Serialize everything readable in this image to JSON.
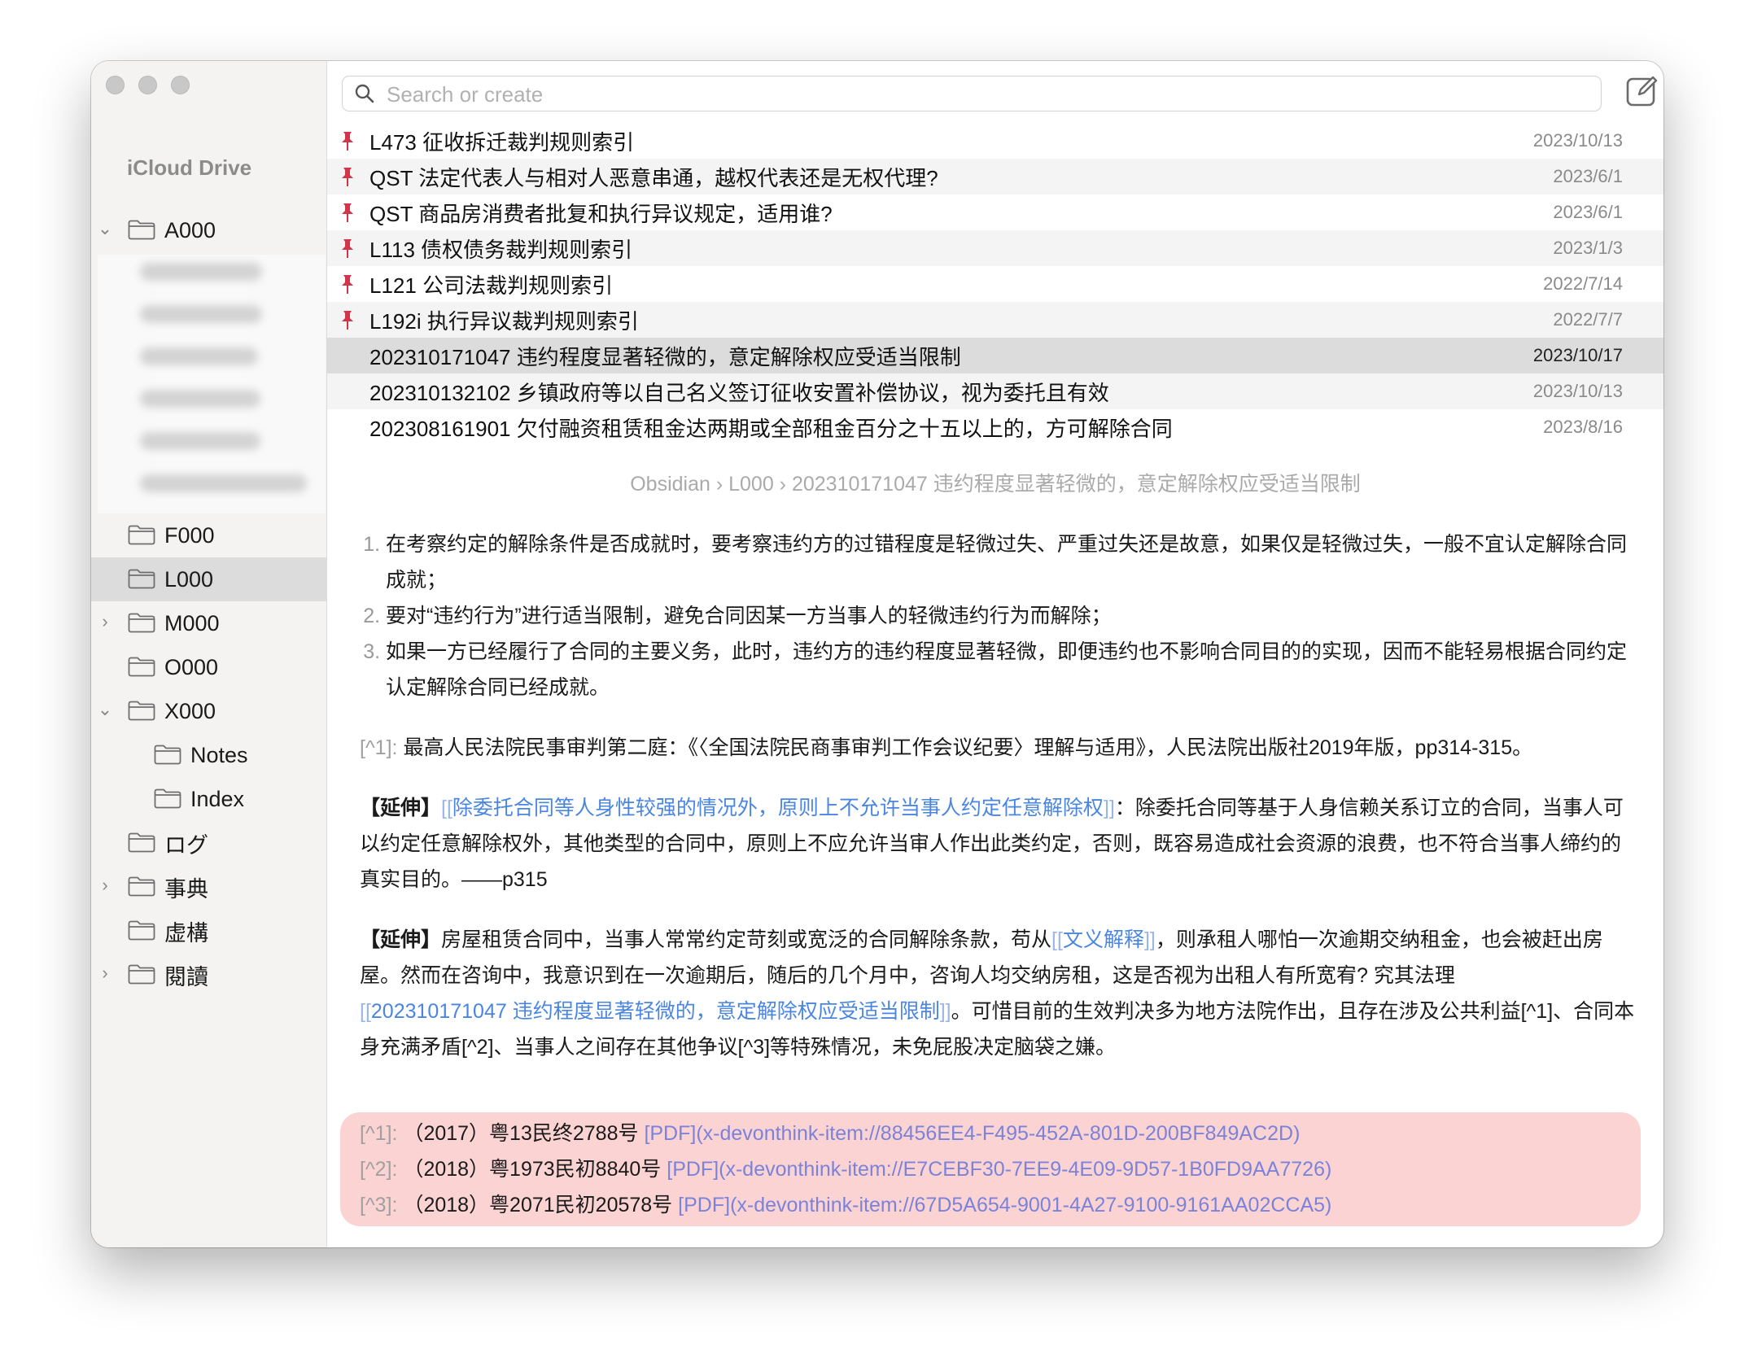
{
  "search": {
    "placeholder": "Search or create"
  },
  "sidebar": {
    "header": "iCloud Drive",
    "folders": [
      {
        "label": "A000",
        "expander": "⌄"
      },
      {
        "label": "F000",
        "expander": ""
      },
      {
        "label": "L000",
        "expander": ""
      },
      {
        "label": "M000",
        "expander": "›"
      },
      {
        "label": "O000",
        "expander": ""
      },
      {
        "label": "X000",
        "expander": "⌄"
      },
      {
        "label": "Notes",
        "expander": ""
      },
      {
        "label": "Index",
        "expander": ""
      },
      {
        "label": "ログ",
        "expander": ""
      },
      {
        "label": "事典",
        "expander": "›"
      },
      {
        "label": "虚構",
        "expander": ""
      },
      {
        "label": "閱讀",
        "expander": "›"
      }
    ],
    "selected": "L000"
  },
  "notes": [
    {
      "title": "L473 征收拆迁裁判规则索引",
      "date": "2023/10/13",
      "pinned": true
    },
    {
      "title": "QST 法定代表人与相对人恶意串通，越权代表还是无权代理?",
      "date": "2023/6/1",
      "pinned": true
    },
    {
      "title": "QST 商品房消费者批复和执行异议规定，适用谁?",
      "date": "2023/6/1",
      "pinned": true
    },
    {
      "title": "L113 债权债务裁判规则索引",
      "date": "2023/1/3",
      "pinned": true
    },
    {
      "title": "L121 公司法裁判规则索引",
      "date": "2022/7/14",
      "pinned": true
    },
    {
      "title": "L192i 执行异议裁判规则索引",
      "date": "2022/7/7",
      "pinned": true
    },
    {
      "title": "202310171047 违约程度显著轻微的，意定解除权应受适当限制",
      "date": "2023/10/17",
      "pinned": false
    },
    {
      "title": "202310132102 乡镇政府等以自己名义签订征收安置补偿协议，视为委托且有效",
      "date": "2023/10/13",
      "pinned": false
    },
    {
      "title": "202308161901 欠付融资租赁租金达两期或全部租金百分之十五以上的，方可解除合同",
      "date": "2023/8/16",
      "pinned": false
    }
  ],
  "breadcrumb": "Obsidian › L000 › 202310171047 违约程度显著轻微的，意定解除权应受适当限制",
  "content": {
    "list": [
      "在考察约定的解除条件是否成就时，要考察违约方的过错程度是轻微过失、严重过失还是故意，如果仅是轻微过失，一般不宜认定解除合同成就；",
      "要对“违约行为”进行适当限制，避免合同因某一方当事人的轻微违约行为而解除；",
      "如果一方已经履行了合同的主要义务，此时，违约方的违约程度显著轻微，即便违约也不影响合同目的的实现，因而不能轻易根据合同约定认定解除合同已经成就。"
    ],
    "footnote_ref": {
      "marker": "[^1]:",
      "text": "最高人民法院民事审判第二庭：《〈全国法院民商事审判工作会议纪要〉理解与适用》，人民法院出版社2019年版，pp314-315。"
    },
    "para1": {
      "label": "【延伸】",
      "open": "[[",
      "link": "除委托合同等人身性较强的情况外，原则上不允许当事人约定任意解除权",
      "close": "]]",
      "rest": "：除委托合同等基于人身信赖关系订立的合同，当事人可以约定任意解除权外，其他类型的合同中，原则上不应允许当审人作出此类约定，否则，既容易造成社会资源的浪费，也不符合当事人缔约的真实目的。——p315"
    },
    "para2": {
      "label": "【延伸】",
      "t1": "房屋租赁合同中，当事人常常约定苛刻或宽泛的合同解除条款，苟从",
      "open1": "[[",
      "link1": "文义解释",
      "close1": "]]",
      "t2": "，则承租人哪怕一次逾期交纳租金，也会被赶出房屋。然而在咨询中，我意识到在一次逾期后，随后的几个月中，咨询人均交纳房租，这是否视为出租人有所宽宥? 究其法理",
      "open2": "[[",
      "link2": "202310171047 违约程度显著轻微的，意定解除权应受适当限制",
      "close2": "]]",
      "t3": "。可惜目前的生效判决多为地方法院作出，且存在涉及公共利益[^1]、合同本身充满矛盾[^2]、当事人之间存在其他争议[^3]等特殊情况，未免屁股决定脑袋之嫌。"
    }
  },
  "footnotes": [
    {
      "marker": "[^1]:",
      "case": "（2017）粤13民终2788号",
      "pdf": "[PDF]",
      "url": "(x-devonthink-item://88456EE4-F495-452A-801D-200BF849AC2D)"
    },
    {
      "marker": "[^2]:",
      "case": "（2018）粤1973民初8840号",
      "pdf": "[PDF]",
      "url": "(x-devonthink-item://E7CEBF30-7EE9-4E09-9D57-1B0FD9AA7726)"
    },
    {
      "marker": "[^3]:",
      "case": "（2018）粤2071民初20578号",
      "pdf": "[PDF]",
      "url": "(x-devonthink-item://67D5A654-9001-4A27-9100-9161AA02CCA5)"
    }
  ],
  "colors": {
    "accent": "#4a86e0",
    "pin": "#d0354a",
    "footnote_bg": "#fbd3d3",
    "selected": "#dcdcdc"
  },
  "icons": {
    "search": "search-icon",
    "compose": "compose-icon",
    "folder": "folder-icon",
    "pin": "pin-icon"
  }
}
